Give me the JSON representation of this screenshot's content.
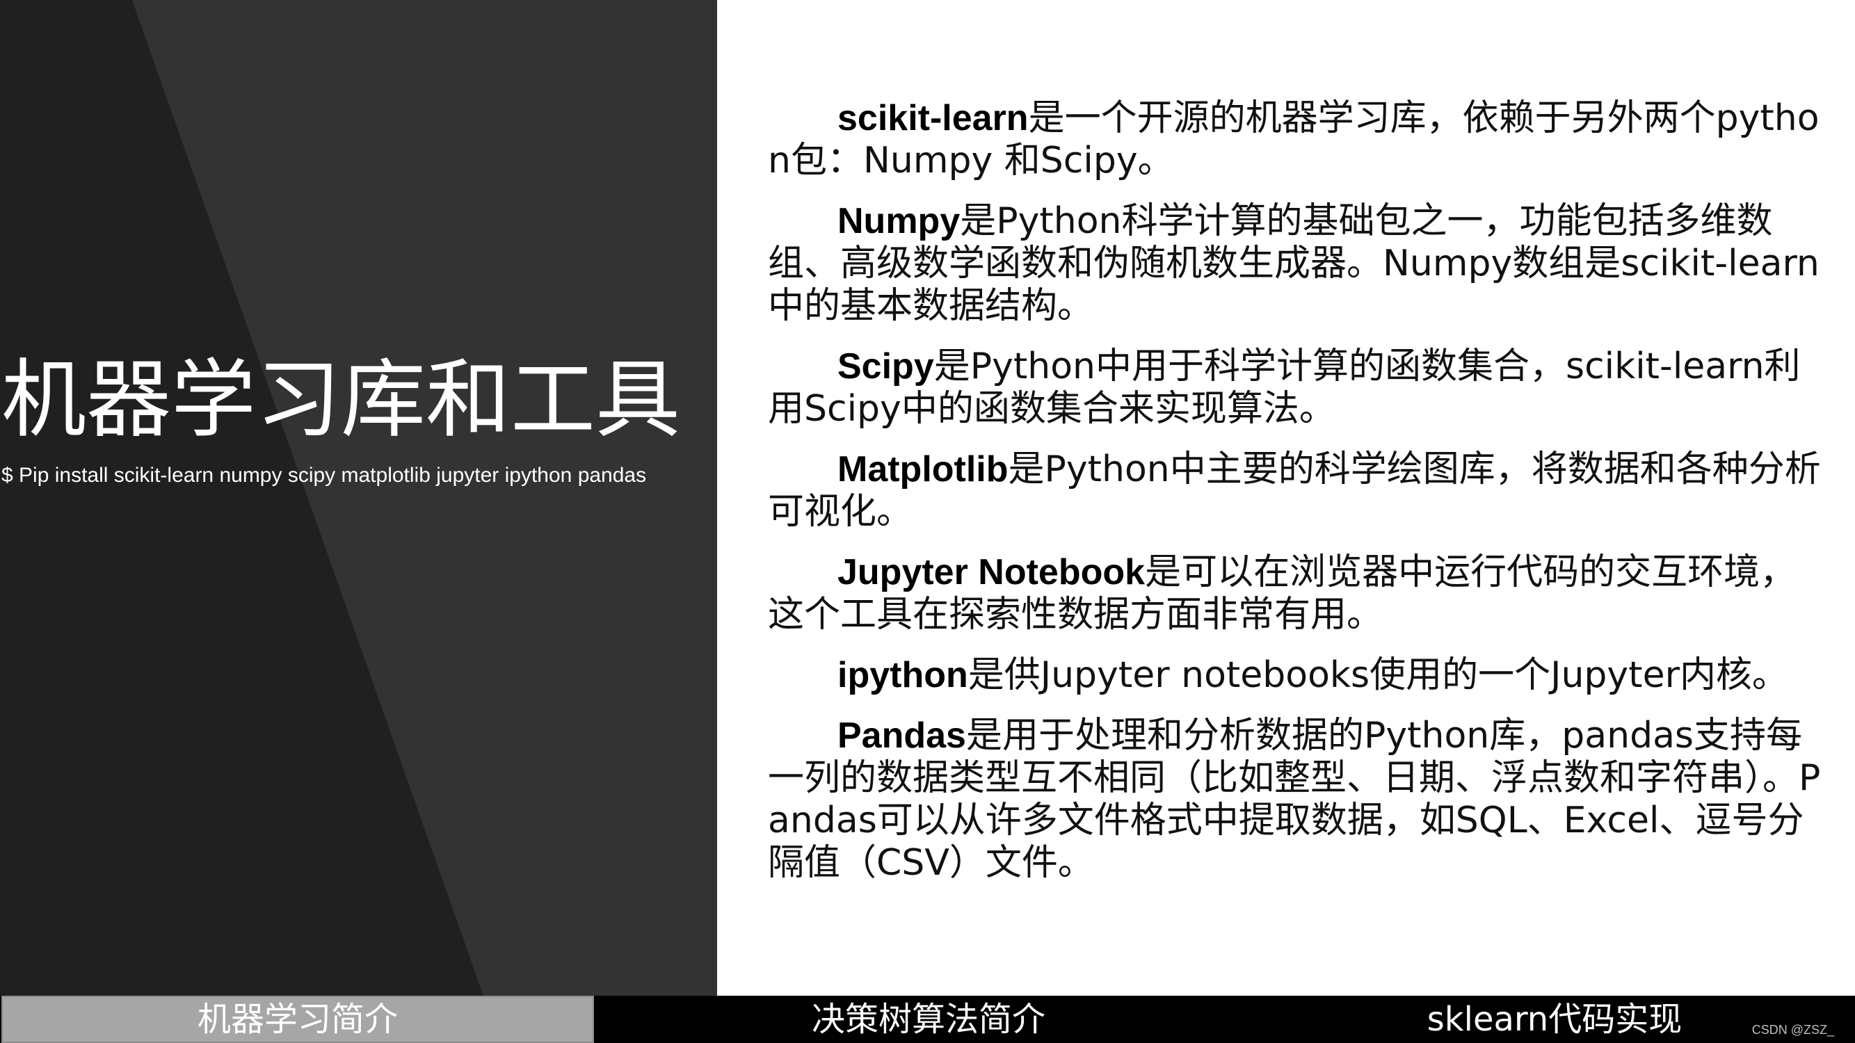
{
  "left": {
    "title": "机器学习库和工具",
    "install_command": "$ Pip install scikit-learn numpy scipy matplotlib jupyter ipython  pandas"
  },
  "paragraphs": [
    {
      "term": "scikit-learn",
      "text": "是一个开源的机器学习库，依赖于另外两个python包：Numpy 和Scipy。"
    },
    {
      "term": "Numpy",
      "text": "是Python科学计算的基础包之一，功能包括多维数组、高级数学函数和伪随机数生成器。Numpy数组是scikit-learn中的基本数据结构。"
    },
    {
      "term": "Scipy",
      "text": "是Python中用于科学计算的函数集合，scikit-learn利用Scipy中的函数集合来实现算法。"
    },
    {
      "term": "Matplotlib",
      "text": "是Python中主要的科学绘图库，将数据和各种分析可视化。"
    },
    {
      "term": "Jupyter Notebook",
      "text": "是可以在浏览器中运行代码的交互环境，这个工具在探索性数据方面非常有用。"
    },
    {
      "term": "ipython",
      "text": "是供Jupyter notebooks使用的一个Jupyter内核。"
    },
    {
      "term": "Pandas",
      "text": "是用于处理和分析数据的Python库，pandas支持每一列的数据类型互不相同（比如整型、日期、浮点数和字符串）。Pandas可以从许多文件格式中提取数据，如SQL、Excel、逗号分隔值（CSV）文件。"
    }
  ],
  "nav": {
    "tabs": [
      {
        "label": "机器学习简介",
        "active": true
      },
      {
        "label": "决策树算法简介",
        "active": false
      },
      {
        "label": "sklearn代码实现",
        "active": false
      }
    ]
  },
  "watermark": "CSDN @ZSZ_",
  "colors": {
    "left_panel_dark": "#202020",
    "left_panel_facet": "#333333",
    "active_tab": "#a6a6a6",
    "nav_bar": "#000000"
  }
}
